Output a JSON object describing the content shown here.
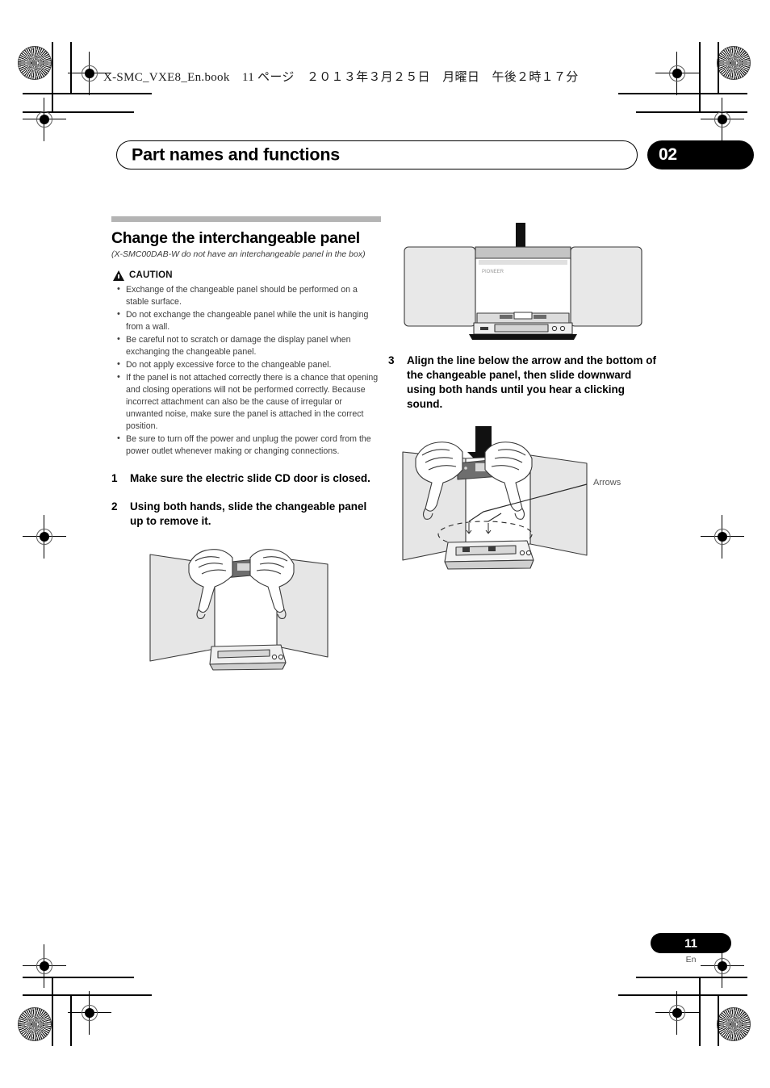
{
  "header": {
    "file_line": "X-SMC_VXE8_En.book　11 ページ　２０１３年３月２５日　月曜日　午後２時１７分",
    "chapter_title": "Part names and functions",
    "chapter_number": "02"
  },
  "section": {
    "heading": "Change the interchangeable panel",
    "subnote": "(X-SMC00DAB-W do not have an interchangeable panel in the box)",
    "caution_label": "CAUTION",
    "cautions": [
      "Exchange of the changeable panel should be performed on a stable surface.",
      "Do not exchange the changeable panel while the unit is hanging from a wall.",
      "Be careful not to scratch or damage the display panel when exchanging the changeable panel.",
      "Do not apply excessive force to the changeable panel.",
      "If the panel is not attached correctly there is a chance that opening and closing operations will not be performed correctly. Because incorrect attachment can also be the cause of irregular or unwanted noise, make sure the panel is attached in the correct position.",
      "Be sure to turn off the power and unplug the power cord from the power outlet whenever making or changing connections."
    ]
  },
  "steps": [
    {
      "number": "1",
      "text": "Make sure the electric slide CD door is closed."
    },
    {
      "number": "2",
      "text": "Using both hands, slide the changeable panel up to remove it."
    },
    {
      "number": "3",
      "text": "Align the line below the arrow and the bottom of the changeable panel, then slide downward using both hands until you hear a clicking sound."
    }
  ],
  "figures": {
    "removal_unit": {
      "name": "stereo-unit-panel-up-arrow"
    },
    "hands_install": {
      "name": "hands-sliding-panel-down",
      "callout": "Arrows"
    },
    "hands_remove": {
      "name": "hands-sliding-panel-up"
    }
  },
  "footer": {
    "page_number": "11",
    "language": "En"
  },
  "colors": {
    "rule_gray": "#b4b4b4",
    "badge_black": "#000000",
    "body_text": "#3c3c3c"
  }
}
